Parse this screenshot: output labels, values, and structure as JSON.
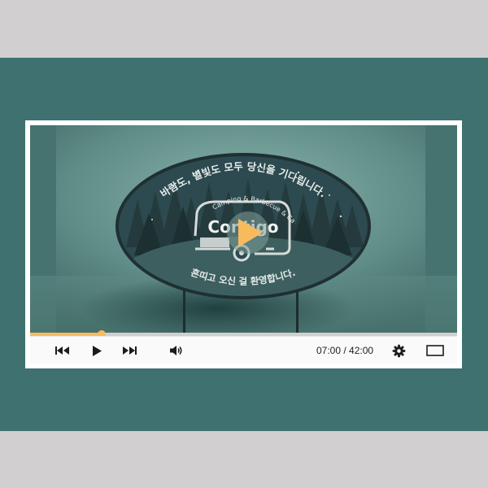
{
  "player": {
    "sign": {
      "top_text": "바람도, 별빛도 모두 당신을 기다립니다.",
      "bottom_text": "흔띠고 오신 걸 환영합니다.",
      "logo_arc_text": "Camping & Barbecue & Cafe",
      "logo_word": "Contigo"
    },
    "progress": {
      "fraction": 0.1667
    },
    "time": {
      "current": "07:00",
      "separator": " / ",
      "total": "42:00"
    },
    "colors": {
      "accent": "#f7bb5e",
      "background_band": "#3f7170",
      "sign_fill": "#2c4a4f"
    },
    "icons": {
      "skip_back": "skip-back-icon",
      "play": "play-icon",
      "skip_forward": "skip-forward-icon",
      "volume": "volume-icon",
      "settings": "gear-icon",
      "fullscreen": "fullscreen-icon",
      "big_play": "big-play-icon"
    }
  }
}
